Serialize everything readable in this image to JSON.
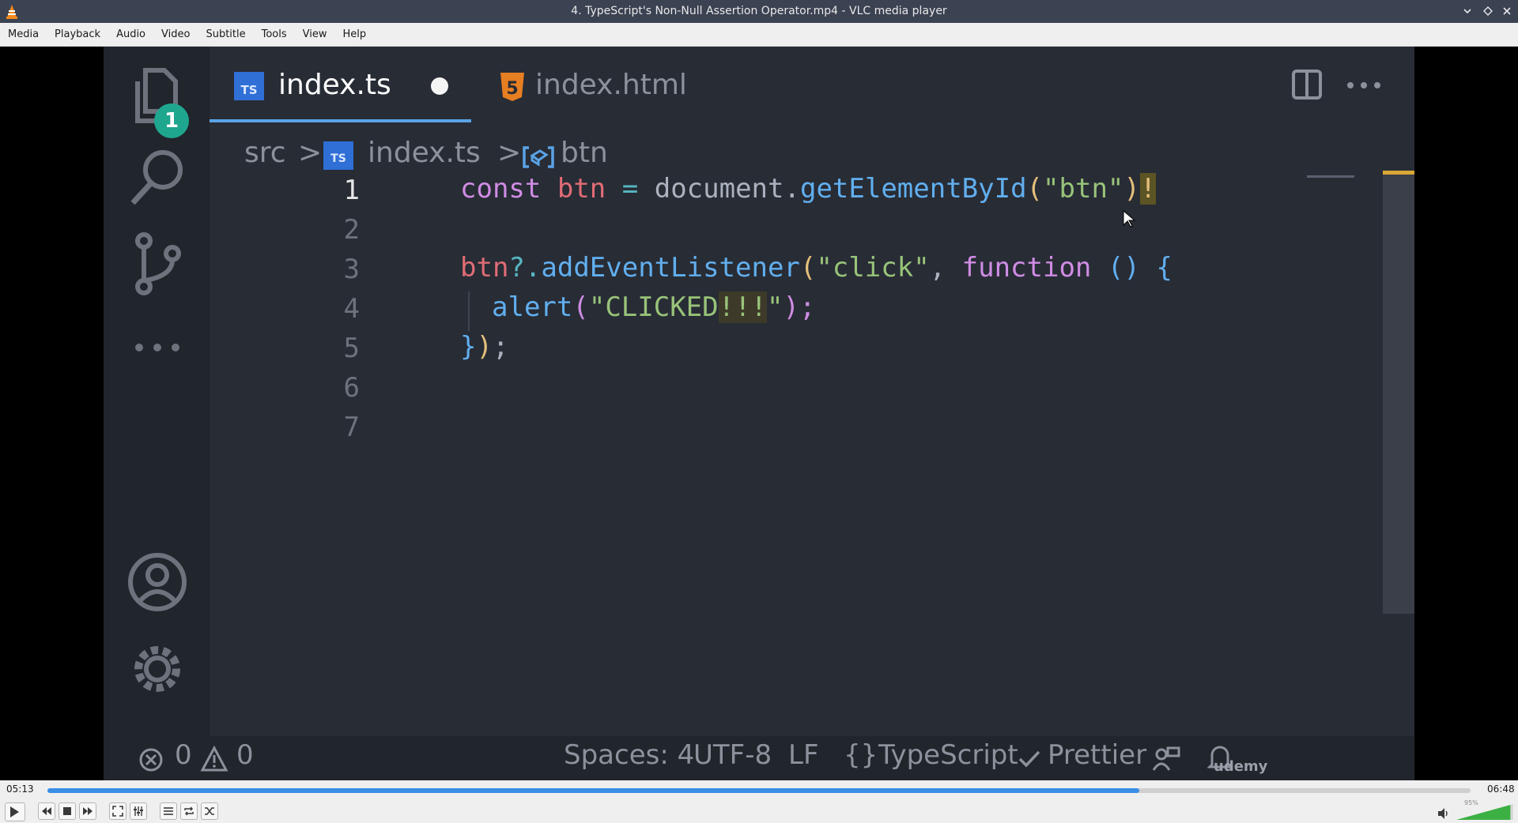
{
  "window": {
    "title": "4. TypeScript's Non-Null Assertion Operator.mp4 - VLC media player"
  },
  "menu": {
    "items": [
      "Media",
      "Playback",
      "Audio",
      "Video",
      "Subtitle",
      "Tools",
      "View",
      "Help"
    ]
  },
  "editor": {
    "explorer_badge": "1",
    "tabs": [
      {
        "icon": "TS",
        "label": "index.ts",
        "active": true,
        "modified": true
      },
      {
        "icon": "5",
        "label": "index.html",
        "active": false,
        "modified": false
      }
    ],
    "breadcrumb": {
      "folder": "src",
      "sep": ">",
      "file": "index.ts",
      "symbol": "btn"
    },
    "line_numbers": [
      "1",
      "2",
      "3",
      "4",
      "5",
      "6",
      "7"
    ],
    "code": {
      "l1_kw": "const",
      "l1_id": "btn",
      "l1_eq": "=",
      "l1_obj": "document",
      "l1_dot": ".",
      "l1_fn": "getElementById",
      "l1_open": "(",
      "l1_str": "\"btn\"",
      "l1_close": ")",
      "l1_bang": "!",
      "l3_id": "btn",
      "l3_op": "?.",
      "l3_fn": "addEventListener",
      "l3_open": "(",
      "l3_str": "\"click\"",
      "l3_comma": ",",
      "l3_kw": "function",
      "l3_parens": "()",
      "l3_brace": "{",
      "l4_fn": "alert",
      "l4_open": "(",
      "l4_str_a": "\"CLICKED",
      "l4_str_b": "!!!",
      "l4_str_c": "\"",
      "l4_close": ");",
      "l5_brace": "}",
      "l5_paren": ")",
      "l5_semi": ";"
    },
    "status": {
      "errors": "0",
      "warnings": "0",
      "spaces": "Spaces: 4",
      "encoding": "UTF-8",
      "eol": "LF",
      "lang_braces": "{}",
      "language": "TypeScript",
      "formatter": "Prettier",
      "watermark": "udemy"
    }
  },
  "player": {
    "elapsed": "05:13",
    "total": "06:48",
    "progress_fraction": 0.767,
    "volume_label": "95%",
    "volume_fraction": 0.95
  },
  "colors": {
    "accent": "#3a8ee6",
    "badge": "#1fa68f",
    "vlc_orange": "#f48a1c"
  }
}
